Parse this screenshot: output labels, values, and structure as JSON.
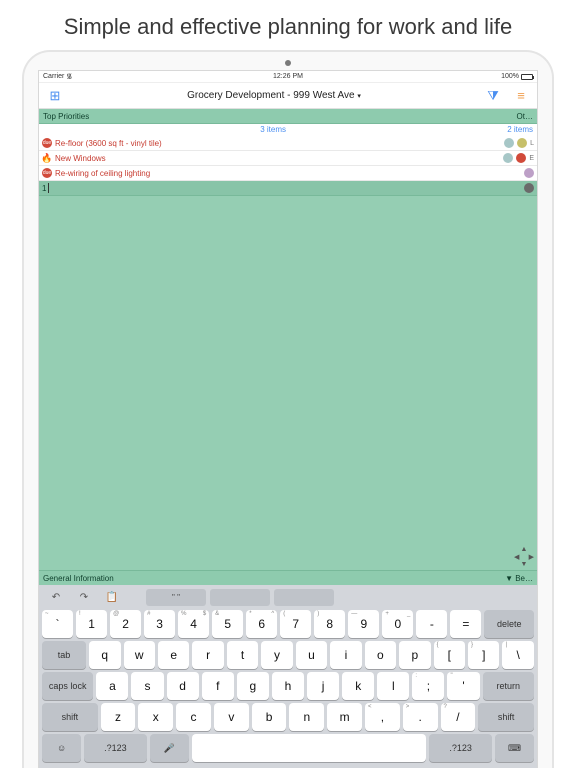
{
  "headline": "Simple and effective planning for work and life",
  "statusbar": {
    "carrier": "Carrier",
    "wifi": "᯾",
    "time": "12:26 PM",
    "pct": "100%"
  },
  "nav": {
    "grid_icon": "⊞",
    "title": "Grocery Development - 999 West Ave",
    "caret": "▾",
    "filter_icon": "⧩",
    "menu_icon": "≡"
  },
  "top_section": {
    "label": "Top Priorities",
    "right": "Ot…",
    "count": "3 items",
    "right_count": "2 items"
  },
  "rows": [
    {
      "badge": "due",
      "badge_text": "due",
      "text": "Re-floor (3600 sq ft - vinyl tile)",
      "avatars": [
        "",
        "y"
      ],
      "extra": "L"
    },
    {
      "badge": "fire",
      "badge_text": "🔥",
      "text": "New Windows",
      "avatars": [
        "",
        "r"
      ],
      "extra": "E"
    },
    {
      "badge": "due",
      "badge_text": "due",
      "text": "Re-wiring of ceiling lighting",
      "avatars": [
        "p"
      ],
      "extra": ""
    }
  ],
  "input": {
    "text": "1"
  },
  "bottom_section": {
    "label": "General Information",
    "right": "▼ Be…"
  },
  "toolbar": {
    "undo": "↶",
    "redo": "↷",
    "paste": "📋",
    "seg1": "\" \"",
    "seg2": "",
    "seg3": ""
  },
  "num_syms": [
    "~",
    "!",
    "@",
    "#",
    "%",
    "&",
    "*",
    "(",
    ")",
    "—",
    "+"
  ],
  "num_row": [
    "`",
    "1",
    "2",
    "3",
    "4",
    "5",
    "6",
    "7",
    "8",
    "9",
    "0",
    "-",
    "=",
    "delete"
  ],
  "num_sup": [
    "",
    "",
    "",
    "",
    "$",
    "",
    "^",
    "",
    "",
    "",
    "_",
    ""
  ],
  "qrow": [
    "tab",
    "q",
    "w",
    "e",
    "r",
    "t",
    "y",
    "u",
    "i",
    "o",
    "p",
    "[",
    "]",
    "\\"
  ],
  "qrow_alt": [
    "",
    "",
    "",
    "",
    "",
    "",
    "",
    "",
    "",
    "",
    "",
    "{",
    "}",
    "|"
  ],
  "arow": [
    "caps lock",
    "a",
    "s",
    "d",
    "f",
    "g",
    "h",
    "j",
    "k",
    "l",
    ";",
    "'",
    "return"
  ],
  "arow_alt": [
    "",
    "",
    "",
    "",
    "",
    "",
    "",
    "",
    "",
    "",
    ":",
    "\"",
    ""
  ],
  "zrow": [
    "shift",
    "z",
    "x",
    "c",
    "v",
    "b",
    "n",
    "m",
    ",",
    ".",
    "/",
    "shift"
  ],
  "zrow_alt": [
    "",
    "",
    "",
    "",
    "",
    "",
    "",
    "",
    "<",
    ">",
    "?",
    ""
  ],
  "bottomrow": [
    "☺",
    ".?123",
    "🎤",
    " ",
    ".?123",
    "⌨"
  ]
}
